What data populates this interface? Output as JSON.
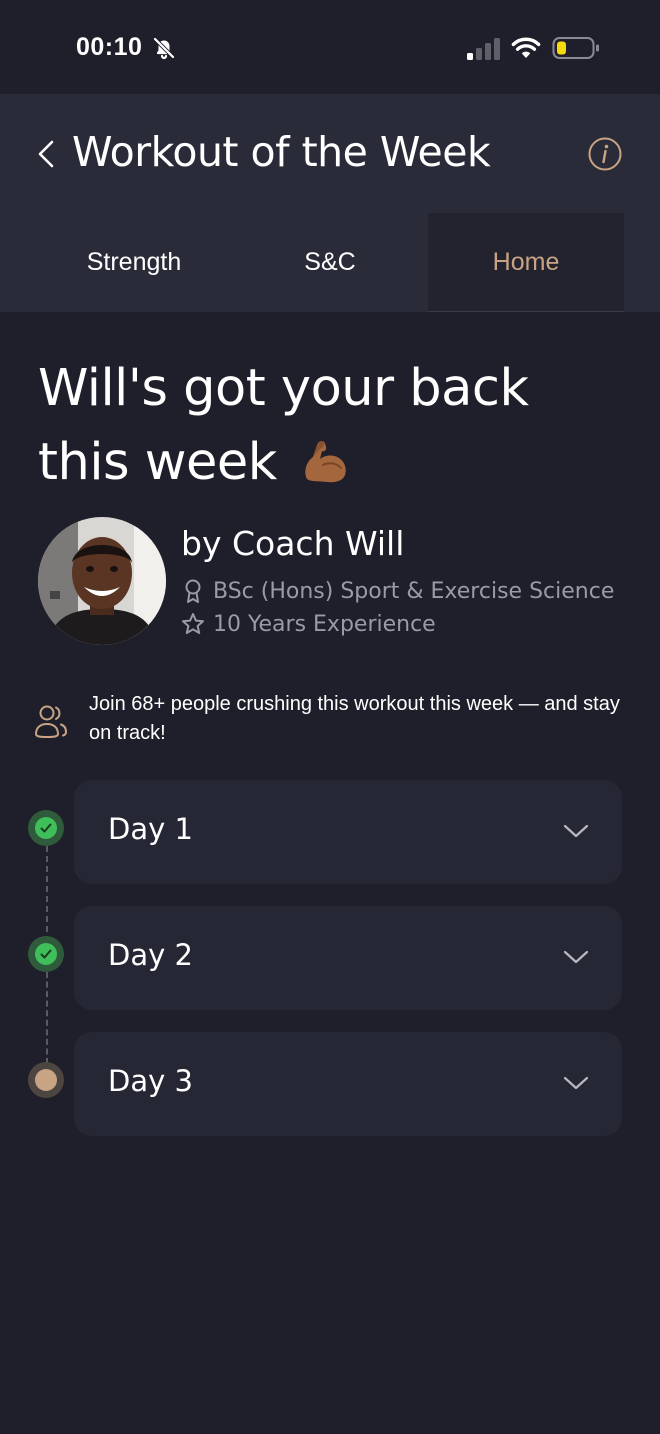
{
  "status_bar": {
    "time": "00:10",
    "icons": [
      "bell-off-icon",
      "signal-icon",
      "wifi-icon",
      "battery-low-icon"
    ]
  },
  "header": {
    "title": "Workout of the Week",
    "back_icon": "chevron-left-icon",
    "info_icon": "info-icon"
  },
  "tabs": [
    {
      "label": "Strength",
      "active": false
    },
    {
      "label": "S&C",
      "active": false
    },
    {
      "label": "Home",
      "active": true
    }
  ],
  "hero": {
    "title_line1": "Will's got your back",
    "title_line2": "this week",
    "emoji_icon": "flexed-biceps-icon"
  },
  "coach": {
    "name": "by Coach Will",
    "qualification": "BSc (Hons) Sport & Exercise Science",
    "experience": "10 Years Experience",
    "qualification_icon": "award-icon",
    "experience_icon": "star-icon"
  },
  "join_banner": {
    "text": "Join 68+ people crushing this workout this week — and stay on track!",
    "icon": "people-icon"
  },
  "days": [
    {
      "label": "Day 1",
      "status": "completed"
    },
    {
      "label": "Day 2",
      "status": "completed"
    },
    {
      "label": "Day 3",
      "status": "pending"
    }
  ],
  "colors": {
    "background": "#1f1f2b",
    "header_background": "#2a2b38",
    "card_background": "#262734",
    "accent": "#c8a484",
    "success": "#3fbf5a",
    "muted_text": "#9a9aa8"
  }
}
